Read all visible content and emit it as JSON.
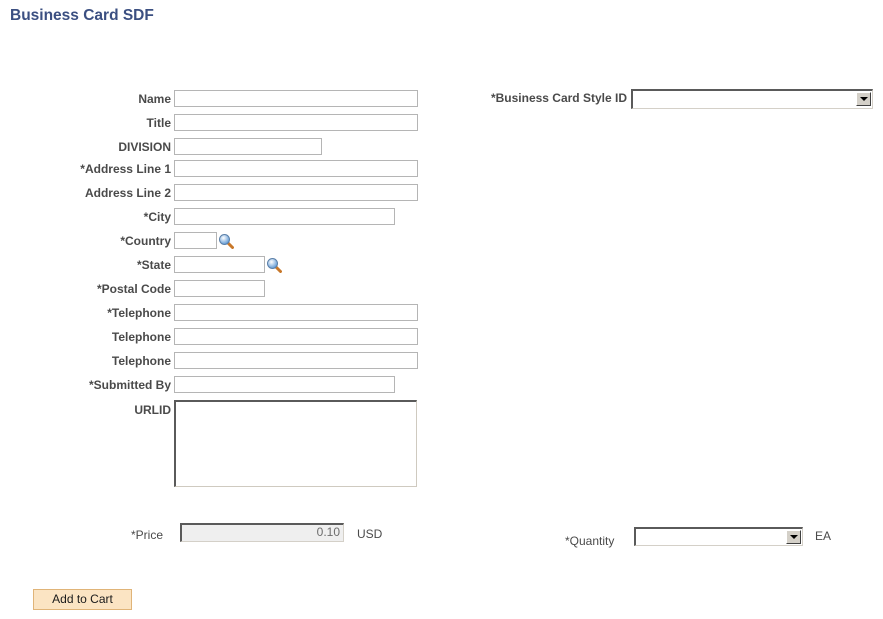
{
  "page": {
    "title": "Business Card SDF"
  },
  "form": {
    "name": {
      "label": "Name",
      "value": ""
    },
    "title": {
      "label": "Title",
      "value": ""
    },
    "division": {
      "label": "DIVISION",
      "value": ""
    },
    "address1": {
      "label": "*Address Line 1",
      "value": ""
    },
    "address2": {
      "label": "Address Line 2",
      "value": ""
    },
    "city": {
      "label": "*City",
      "value": ""
    },
    "country": {
      "label": "*Country",
      "value": "",
      "icon": "lookup-magnifier-icon"
    },
    "state": {
      "label": "*State",
      "value": "",
      "icon": "lookup-magnifier-icon"
    },
    "postal_code": {
      "label": "*Postal Code",
      "value": ""
    },
    "telephone1": {
      "label": "*Telephone",
      "value": ""
    },
    "telephone2": {
      "label": "Telephone",
      "value": ""
    },
    "telephone3": {
      "label": "Telephone",
      "value": ""
    },
    "submitted_by": {
      "label": "*Submitted By",
      "value": ""
    },
    "urlid": {
      "label": "URLID",
      "value": ""
    },
    "style_id": {
      "label": "*Business Card Style ID",
      "selected": ""
    },
    "price": {
      "label": "*Price",
      "value": "0.10",
      "currency": "USD"
    },
    "quantity": {
      "label": "*Quantity",
      "selected": "",
      "unit": "EA"
    }
  },
  "actions": {
    "add_to_cart": "Add to Cart"
  }
}
